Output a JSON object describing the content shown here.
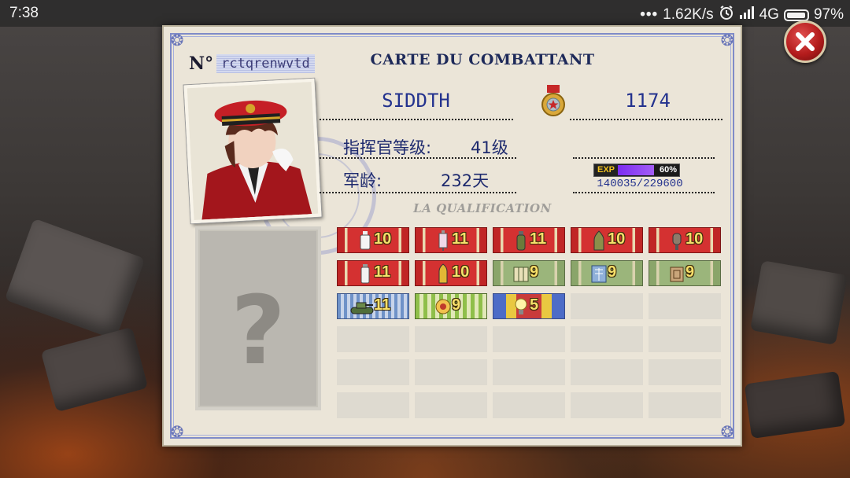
{
  "status_bar": {
    "time": "7:38",
    "dots": "•••",
    "speed": "1.62K/s",
    "network": "4G",
    "battery_pct": "97%",
    "battery_level": 0.97
  },
  "card": {
    "serial_label": "N°",
    "serial_value": "rctqrenwvtd",
    "title": "CARTE DU COMBATTANT",
    "name": "SIDDTH",
    "score": "1174",
    "level_label": "指挥官等级:",
    "level_value": "41级",
    "age_label": "军龄:",
    "age_value": "232天",
    "exp_label": "EXP",
    "exp_percent": "60%",
    "exp_fraction": 0.6,
    "exp_text": "140035/229600",
    "qualification_title": "LA QUALIFICATION",
    "mystery_mark": "?"
  },
  "qualifications": [
    {
      "style": "red",
      "icon": "bottle-icon",
      "count": "10"
    },
    {
      "style": "red",
      "icon": "syringe-icon",
      "count": "11"
    },
    {
      "style": "red",
      "icon": "grenade-icon",
      "count": "11"
    },
    {
      "style": "red",
      "icon": "shell-icon",
      "count": "10"
    },
    {
      "style": "red",
      "icon": "hand-icon",
      "count": "10"
    },
    {
      "style": "red",
      "icon": "vial-icon",
      "count": "11"
    },
    {
      "style": "red",
      "icon": "bullet-icon",
      "count": "10"
    },
    {
      "style": "green",
      "icon": "map-icon",
      "count": "9"
    },
    {
      "style": "green",
      "icon": "blueprint-icon",
      "count": "9"
    },
    {
      "style": "green",
      "icon": "crate-icon",
      "count": "9"
    },
    {
      "style": "stripe",
      "icon": "tank-icon",
      "count": "11"
    },
    {
      "style": "gstripe",
      "icon": "gear-badge-icon",
      "count": "9"
    },
    {
      "style": "rainbow",
      "icon": "lightbulb-icon",
      "count": "5"
    }
  ],
  "colors": {
    "accent_blue": "#23328e",
    "exp_purple": "#7b2cf0",
    "close_red": "#b41c1c"
  }
}
